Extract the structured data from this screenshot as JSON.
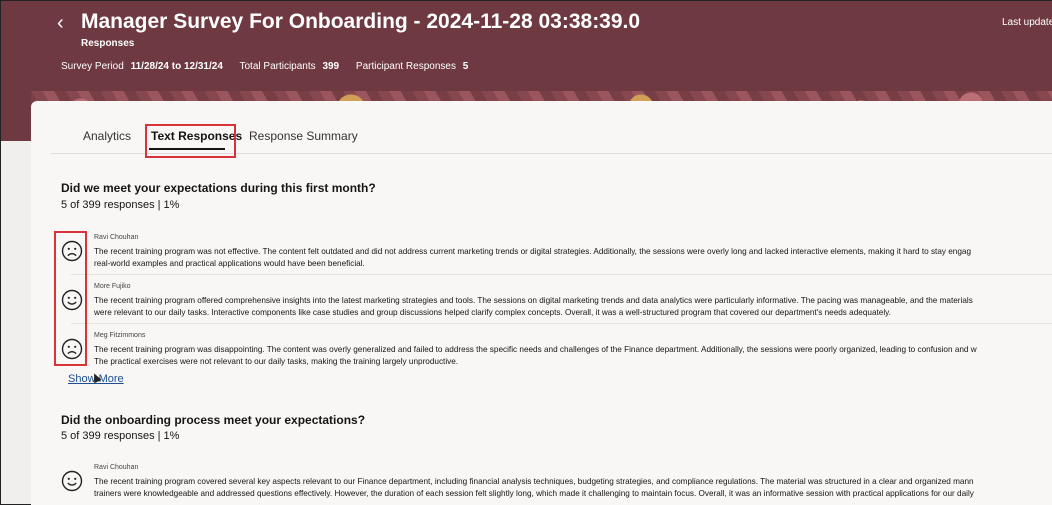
{
  "header": {
    "back_symbol": "‹",
    "title": "Manager Survey For Onboarding - 2024-11-28 03:38:39.0",
    "subtitle": "Responses",
    "last_updated": "Last updated",
    "meta": {
      "survey_period_label": "Survey Period",
      "survey_period_value": "11/28/24 to 12/31/24",
      "participants_label": "Total Participants",
      "participants_value": "399",
      "responses_label": "Participant Responses",
      "responses_value": "5"
    },
    "colors": {
      "banner": "#6e3941"
    }
  },
  "tabs": [
    {
      "label": "Analytics"
    },
    {
      "label": "Text Responses",
      "active": true
    },
    {
      "label": "Response Summary"
    }
  ],
  "questions": [
    {
      "title": "Did we meet your expectations during this first month?",
      "stats": "5 of 399 responses | 1%",
      "responses": [
        {
          "author": "Ravi Chouhan",
          "sentiment": "sad-face-icon",
          "line1": "The recent training program was not effective. The content felt outdated and did not address current marketing trends or digital strategies. Additionally, the sessions were overly long and lacked interactive elements, making it hard to stay engag",
          "line2": "real-world examples and practical applications would have been beneficial."
        },
        {
          "author": "More Fujiko",
          "sentiment": "smile-face-icon",
          "line1": "The recent training program offered comprehensive insights into the latest marketing strategies and tools. The sessions on digital marketing trends and data analytics were particularly informative. The pacing was manageable, and the materials",
          "line2": "were relevant to our daily tasks. Interactive components like case studies and group discussions helped clarify complex concepts. Overall, it was a well-structured program that covered our department's needs adequately."
        },
        {
          "author": "Meg Fitzimmons",
          "sentiment": "sad-face-icon",
          "line1": "The recent training program was disappointing. The content was overly generalized and failed to address the specific needs and challenges of the Finance department. Additionally, the sessions were poorly organized, leading to confusion and w",
          "line2": "The practical exercises were not relevant to our daily tasks, making the training largely unproductive."
        }
      ],
      "show_more": "Show More"
    },
    {
      "title": "Did the onboarding process meet your expectations?",
      "stats": "5 of 399 responses | 1%",
      "responses": [
        {
          "author": "Ravi Chouhan",
          "sentiment": "smile-face-icon",
          "line1": "The recent training program covered several key aspects relevant to our Finance department, including financial analysis techniques, budgeting strategies, and compliance regulations. The material was structured in a clear and organized mann",
          "line2": "trainers were knowledgeable and addressed questions effectively. However, the duration of each session felt slightly long, which made it challenging to maintain focus. Overall, it was an informative session with practical applications for our daily"
        }
      ]
    }
  ],
  "highlight_color": "#d9333a"
}
